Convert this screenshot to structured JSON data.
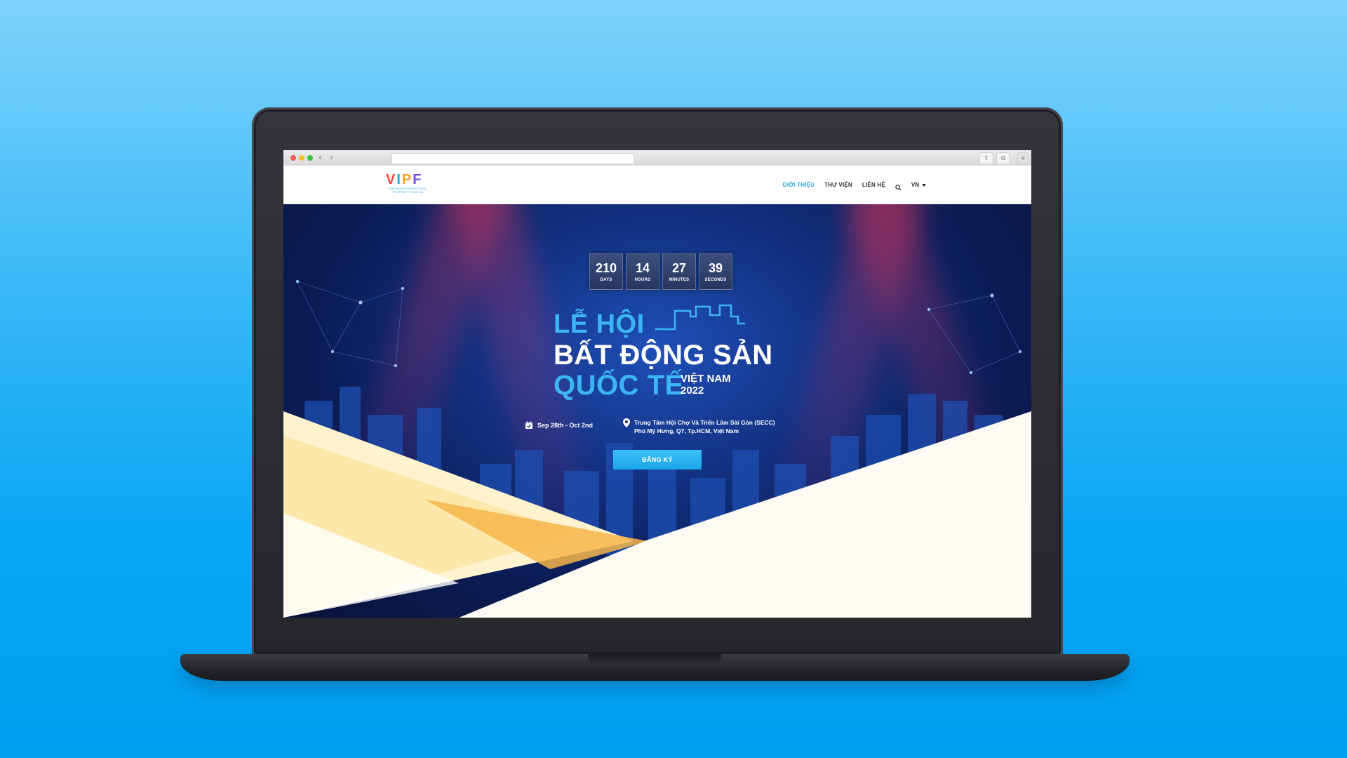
{
  "browser": {
    "back_icon": "chevron-left-icon",
    "forward_icon": "chevron-right-icon",
    "share_icon": "share-icon",
    "tabs_icon": "tabs-icon",
    "new_tab_icon": "plus-icon"
  },
  "header": {
    "logo_letters": [
      "V",
      "I",
      "P",
      "F"
    ],
    "logo_colors": [
      "#e84b3c",
      "#2aa8df",
      "#f5a623",
      "#7b4fd6"
    ],
    "logo_subtitle": "VIETNAM INTERNATIONAL PROPERTY FESTIVAL",
    "nav": [
      {
        "label": "GIỚI THIỆU",
        "active": true
      },
      {
        "label": "THƯ VIỆN",
        "active": false
      },
      {
        "label": "LIÊN HỆ",
        "active": false
      }
    ],
    "search_icon": "search-icon",
    "language": "VN"
  },
  "countdown": [
    {
      "value": "210",
      "label": "DAYS"
    },
    {
      "value": "14",
      "label": "HOURS"
    },
    {
      "value": "27",
      "label": "MINUTES"
    },
    {
      "value": "39",
      "label": "SECONDS"
    }
  ],
  "hero": {
    "line1": "LỄ HỘI",
    "line2": "BẤT ĐỘNG SẢN",
    "line3": "QUỐC TẾ",
    "country": "VIỆT NAM",
    "year": "2022",
    "date": "Sep 28th - Oct 2nd",
    "location_line1": "Trung Tâm Hội Chợ Và Triển Lãm Sài Gòn (SECC)",
    "location_line2": "Phú Mỹ Hưng, Q7, Tp.HCM, Việt Nam",
    "register_label": "ĐĂNG KÝ"
  },
  "colors": {
    "accent": "#2ba4e0",
    "hero_dark": "#0b1c55",
    "title_blue": "#3bb6f2",
    "button": "#1aa5ea"
  }
}
